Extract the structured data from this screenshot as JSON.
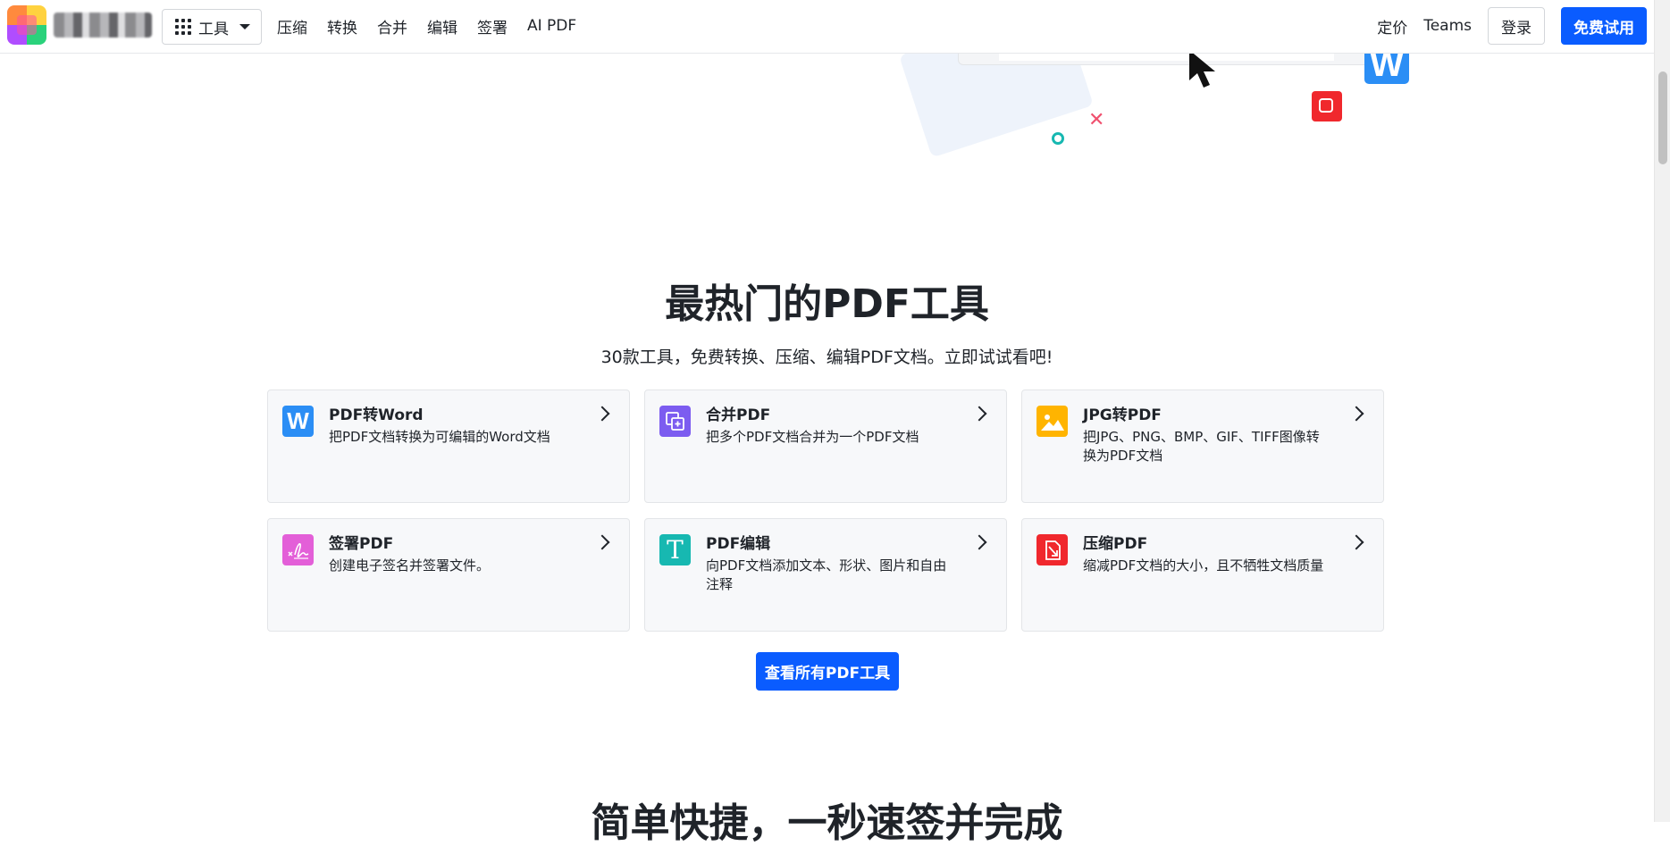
{
  "nav": {
    "tools_label": "工具",
    "links": [
      "压缩",
      "转换",
      "合并",
      "编辑",
      "签署",
      "AI PDF"
    ],
    "pricing": "定价",
    "teams": "Teams",
    "login": "登录",
    "try_free": "免费试用"
  },
  "hero": {
    "word_icon_letter": "W"
  },
  "section": {
    "title": "最热门的PDF工具",
    "subtitle": "30款工具，免费转换、压缩、编辑PDF文档。立即试试看吧!",
    "view_all": "查看所有PDF工具"
  },
  "tools": [
    {
      "title": "PDF转Word",
      "desc": "把PDF文档转换为可编辑的Word文档",
      "icon": "word-icon",
      "color": "#2b8ef5",
      "glyph": "W"
    },
    {
      "title": "合并PDF",
      "desc": "把多个PDF文档合并为一个PDF文档",
      "icon": "merge-icon",
      "color": "#7c5cf0",
      "glyph": ""
    },
    {
      "title": "JPG转PDF",
      "desc": "把JPG、PNG、BMP、GIF、TIFF图像转换为PDF文档",
      "icon": "image-icon",
      "color": "#ffb400",
      "glyph": ""
    },
    {
      "title": "签署PDF",
      "desc": "创建电子签名并签署文件。",
      "icon": "signature-icon",
      "color": "#e35fd8",
      "glyph": ""
    },
    {
      "title": "PDF编辑",
      "desc": "向PDF文档添加文本、形状、图片和自由注释",
      "icon": "text-edit-icon",
      "color": "#17b8b1",
      "glyph": "T"
    },
    {
      "title": "压缩PDF",
      "desc": "缩减PDF文档的大小，且不牺牲文档质量",
      "icon": "compress-icon",
      "color": "#f0282d",
      "glyph": ""
    }
  ],
  "next_section": {
    "title": "简单快捷，一秒速签并完成"
  },
  "colors": {
    "brand_blue": "#0a5cff",
    "card_bg": "#f7f8fa"
  }
}
